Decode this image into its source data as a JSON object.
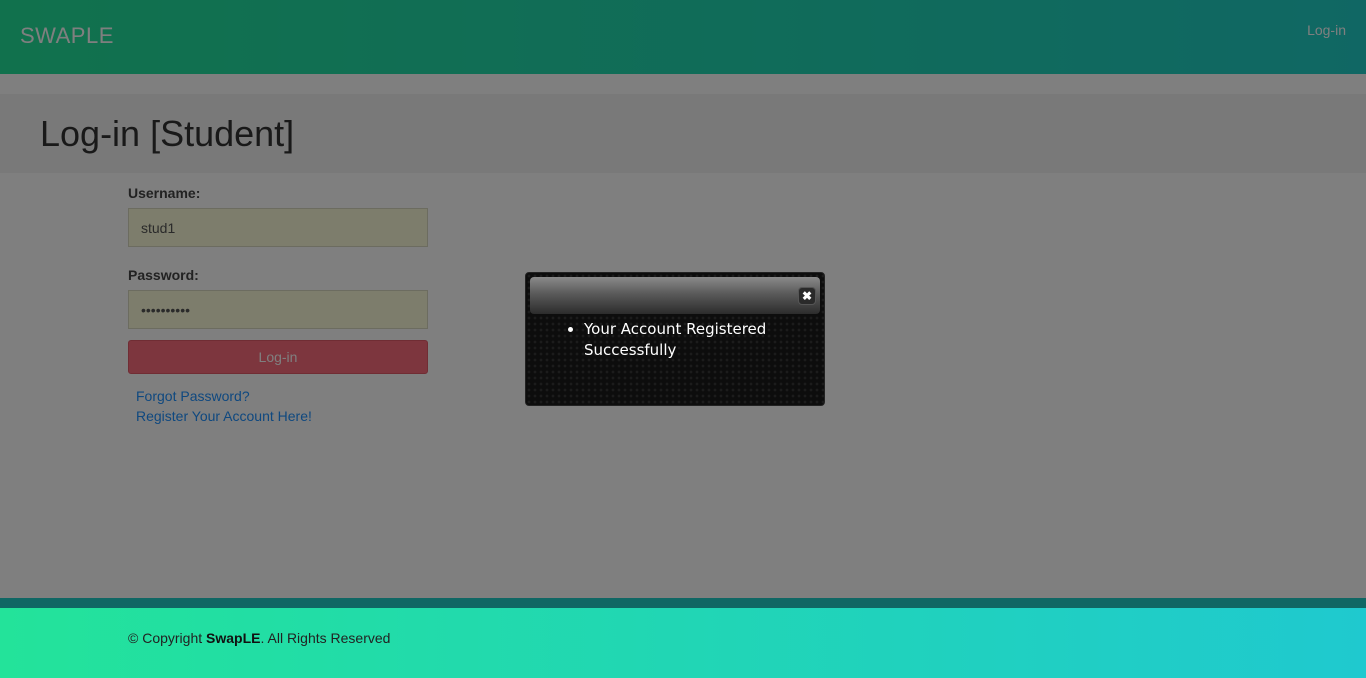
{
  "header": {
    "brand": "SWAPLE",
    "nav_login": "Log-in"
  },
  "page": {
    "title": "Log-in [Student]"
  },
  "form": {
    "username_label": "Username:",
    "username_value": "stud1",
    "password_label": "Password:",
    "password_value": "••••••••••",
    "login_button": "Log-in",
    "forgot_link": "Forgot Password?",
    "register_link": "Register Your Account Here!"
  },
  "footer": {
    "prefix": "© Copyright ",
    "brand": "SwapLE",
    "suffix": ". All Rights Reserved"
  },
  "modal": {
    "close_icon": "close-icon",
    "messages": [
      "Your Account Registered Successfully"
    ]
  },
  "colors": {
    "header_gradient_start": "#23e39a",
    "header_gradient_end": "#20cfc8",
    "login_button": "#fa6d7c",
    "link": "#1e90ff",
    "input_bg": "#fbfbd8",
    "modal_bg": "#0d0d0d"
  }
}
